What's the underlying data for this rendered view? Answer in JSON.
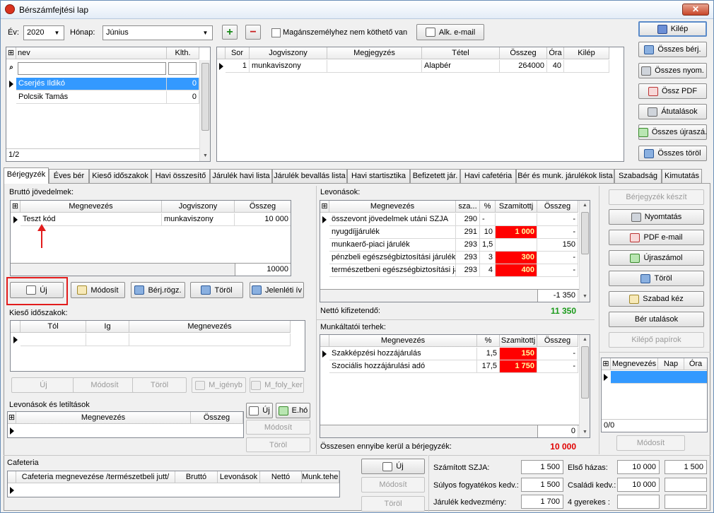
{
  "window": {
    "title": "Bérszámfejtési lap",
    "close": "✕"
  },
  "top": {
    "ev_label": "Év:",
    "ev_value": "2020",
    "honap_label": "Hónap:",
    "honap_value": "Június",
    "add_symbol": "+",
    "remove_symbol": "−",
    "checkbox_label": "Magánszemélyhez nem köthető van",
    "alk_email": "Alk. e-mail"
  },
  "right_buttons": {
    "kilep": "Kilép",
    "osszes_berj": "Összes bérj.",
    "osszes_nyom": "Összes nyom.",
    "ossz_pdf": "Össz PDF",
    "atutalasok": "Átutalások",
    "osszes_ujrasz": "Összes újraszá.",
    "osszes_torol": "Összes töröl"
  },
  "person_grid": {
    "headers": [
      "nev",
      "Klth."
    ],
    "rows": [
      {
        "nev": "Cserjés Ildikó",
        "klth": "0"
      },
      {
        "nev": "Polcsik Tamás",
        "klth": "0"
      }
    ],
    "footer": "1/2"
  },
  "contract_grid": {
    "headers": [
      "Sor",
      "Jogviszony",
      "Megjegyzés",
      "Tétel",
      "Összeg",
      "Óra",
      "Kilép"
    ],
    "rows": [
      {
        "sor": "1",
        "jogviszony": "munkaviszony",
        "megjegyzes": "",
        "tetel": "Alapbér",
        "osszeg": "264000",
        "ora": "40",
        "kilep": ""
      }
    ]
  },
  "tabs": [
    "Bérjegyzék",
    "Éves bér",
    "Kieső időszakok",
    "Havi összesítő",
    "Járulék havi lista",
    "Járulék bevallás lista",
    "Havi startisztika",
    "Befizetett jár.",
    "Havi cafetéria",
    "Bér és munk. járulékok lista",
    "Szabadság",
    "Kimutatás"
  ],
  "brutto": {
    "title": "Bruttó jövedelmek:",
    "headers": [
      "Megnevezés",
      "Jogviszony",
      "Összeg"
    ],
    "rows": [
      {
        "megnevezes": "Teszt kód",
        "jogviszony": "munkaviszony",
        "osszeg": "10 000"
      }
    ],
    "total": "10000",
    "buttons": {
      "uj": "Új",
      "modosit": "Módosít",
      "berjrogz": "Bérj.rögz.",
      "torol": "Töröl",
      "jelenleti": "Jelenléti ív"
    }
  },
  "kieso": {
    "title": "Kieső időszakok:",
    "headers": [
      "Tól",
      "Ig",
      "Megnevezés"
    ],
    "buttons": {
      "uj": "Új",
      "modosit": "Módosít",
      "torol": "Töröl",
      "m_igenyb": "M_igényb",
      "m_foly_ker": "M_foly_ker"
    }
  },
  "levonasok_letiltasok": {
    "title": "Levonások és letiltások",
    "headers": [
      "Megnevezés",
      "Összeg"
    ],
    "buttons": {
      "uj": "Új",
      "eho": "E.hó",
      "modosit": "Módosít",
      "torol": "Töröl"
    }
  },
  "cafeteria": {
    "title": "Cafeteria",
    "headers": [
      "Cafeteria megnevezése /természetbeli jutt/",
      "Bruttó",
      "Levonások",
      "Nettó",
      "Munk.teher"
    ],
    "buttons": {
      "uj": "Új",
      "modosit": "Módosít",
      "torol": "Töröl"
    }
  },
  "levonasok": {
    "title": "Levonások:",
    "headers": [
      "Megnevezés",
      "sza...",
      "%",
      "Szamitottj",
      "Összeg"
    ],
    "rows": [
      {
        "megnevezes": "összevont jövedelmek utáni SZJA",
        "sza": "290",
        "pct": "-",
        "szamitott": "",
        "osszeg": "-",
        "red": false
      },
      {
        "megnevezes": "nyugdíjjárulék",
        "sza": "291",
        "pct": "10",
        "szamitott": "1 000",
        "osszeg": "-",
        "red": true
      },
      {
        "megnevezes": "munkaerő-piaci járulék",
        "sza": "293",
        "pct": "1,5",
        "szamitott": "",
        "osszeg": "150",
        "red": false
      },
      {
        "megnevezes": "pénzbeli egészségbiztosítási járulék",
        "sza": "293",
        "pct": "3",
        "szamitott": "300",
        "osszeg": "-",
        "red": true
      },
      {
        "megnevezes": "természetbeni egészségbiztosítási járu",
        "sza": "293",
        "pct": "4",
        "szamitott": "400",
        "osszeg": "-",
        "red": true
      }
    ],
    "total": "-1 350",
    "netto_label": "Nettó kifizetendő:",
    "netto_value": "11 350"
  },
  "munkaltatoi": {
    "title": "Munkáltatói terhek:",
    "headers": [
      "Megnevezés",
      "%",
      "Szamitottj",
      "Összeg"
    ],
    "rows": [
      {
        "megnevezes": "Szakképzési hozzájárulás",
        "pct": "1,5",
        "szamitott": "150",
        "osszeg": "-"
      },
      {
        "megnevezes": "Szociális hozzájárulási adó",
        "pct": "17,5",
        "szamitott": "1 750",
        "osszeg": "-"
      }
    ],
    "total": "0",
    "osszesen_label": "Összesen ennyibe kerül a bérjegyzék:",
    "osszesen_value": "10 000"
  },
  "side_actions": {
    "berjegyzek_keszit": "Bérjegyzék készít",
    "nyomtatas": "Nyomtatás",
    "pdf_email": "PDF e-mail",
    "ujraszamol": "Újraszámol",
    "torol": "Töröl",
    "szabad_kez": "Szabad kéz",
    "ber_utalasok": "Bér utalások",
    "kilepo_papirok": "Kilépő papírok"
  },
  "nap_grid": {
    "headers": [
      "Megnevezés",
      "Nap",
      "Óra"
    ],
    "footer": "0/0",
    "modosit": "Módosít"
  },
  "summary": {
    "szamitott_szja_label": "Számított SZJA:",
    "szamitott_szja": "1 500",
    "elso_hazas_label": "Első házas:",
    "elso_hazas": "10 000",
    "elso_hazas2": "1 500",
    "sulyos_label": "Súlyos fogyatékos kedv.:",
    "sulyos": "1 500",
    "csaladi_label": "Családi kedv.:",
    "csaladi": "10 000",
    "jarulek_label": "Járulék kedvezmény:",
    "jarulek": "1 700",
    "gyerekes_label": "4 gyerekes :"
  },
  "colors": {
    "accent_blue": "#3399ff",
    "alert_red": "#ff0000",
    "netto_green": "#1a9a1a",
    "total_red": "#e00000",
    "highlight_box": "#e21c1c"
  }
}
